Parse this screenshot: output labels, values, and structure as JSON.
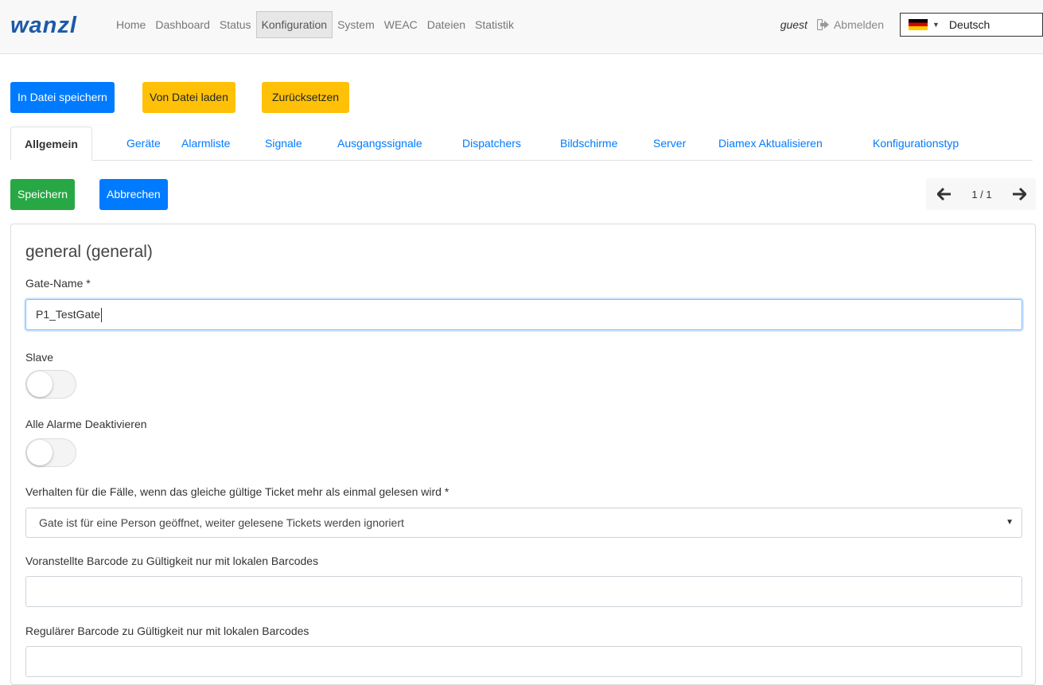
{
  "navbar": {
    "logo": "wanzl",
    "links": [
      "Home",
      "Dashboard",
      "Status",
      "Konfiguration",
      "System",
      "WEAC",
      "Dateien",
      "Statistik"
    ],
    "active_index": 3,
    "user": "guest",
    "logout_label": "Abmelden",
    "language": "Deutsch"
  },
  "file_actions": {
    "save_to_file": "In Datei speichern",
    "load_from_file": "Von Datei laden",
    "reset": "Zurücksetzen"
  },
  "tabs": [
    "Allgemein",
    "Geräte",
    "Alarmliste",
    "Signale",
    "Ausgangssignale",
    "Dispatchers",
    "Bildschirme",
    "Server",
    "Diamex Aktualisieren",
    "Konfigurationstyp"
  ],
  "form_actions": {
    "save": "Speichern",
    "cancel": "Abbrechen"
  },
  "pager": {
    "text": "1 / 1"
  },
  "form": {
    "title": "general (general)",
    "gate_name_label": "Gate-Name *",
    "gate_name_value": "P1_TestGate",
    "slave_label": "Slave",
    "slave_on": false,
    "disable_alarms_label": "Alle Alarme Deaktivieren",
    "disable_alarms_on": false,
    "ticket_behavior_label": "Verhalten für die Fälle, wenn das gleiche gültige Ticket mehr als einmal gelesen wird *",
    "ticket_behavior_value": "Gate ist für eine Person geöffnet, weiter gelesene Tickets werden ignoriert",
    "prefixed_barcode_label": "Voranstellte Barcode zu Gültigkeit nur mit lokalen Barcodes",
    "prefixed_barcode_value": "",
    "regular_barcode_label": "Regulärer Barcode zu Gültigkeit nur mit lokalen Barcodes",
    "regular_barcode_value": ""
  },
  "colors": {
    "primary": "#007bff",
    "warning": "#ffc107",
    "success": "#28a745",
    "logo": "#1d5aa8"
  }
}
